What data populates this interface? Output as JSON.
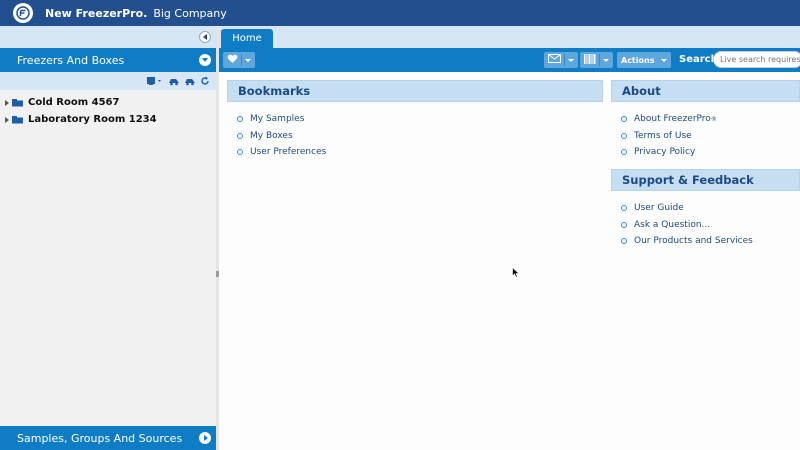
{
  "header": {
    "brand": "New FreezerPro.",
    "company": "Big Company"
  },
  "sidebar": {
    "freezers_header": "Freezers And Boxes",
    "tree": [
      {
        "label": "Cold Room 4567"
      },
      {
        "label": "Laboratory Room 1234"
      }
    ],
    "samples_header": "Samples, Groups And Sources"
  },
  "tabs": [
    {
      "label": "Home",
      "active": true
    }
  ],
  "toolbar": {
    "actions_label": "Actions",
    "search_label": "Search:",
    "search_placeholder": "Live search requires"
  },
  "bookmarks": {
    "title": "Bookmarks",
    "items": [
      "My Samples",
      "My Boxes",
      "User Preferences"
    ]
  },
  "about": {
    "title": "About",
    "items": [
      "About FreezerPro",
      "Terms of Use",
      "Privacy Policy"
    ],
    "registered_mark": "®"
  },
  "support": {
    "title": "Support & Feedback",
    "items": [
      "User Guide",
      "Ask a Question...",
      "Our Products and Services"
    ]
  },
  "colors": {
    "header_bg": "#22508f",
    "accent_blue": "#0f7dc5",
    "light_blue": "#d6e6f5",
    "panel_title_bg": "#c5def2"
  },
  "icons": [
    "freezerpro-logo-icon",
    "collapse-left-icon",
    "chevron-down-icon",
    "chevron-right-icon",
    "add-freezer-icon",
    "truck-icon",
    "refresh-icon",
    "folder-icon",
    "heart-icon",
    "mail-icon",
    "barcode-icon",
    "bullet-icon",
    "mouse-pointer-icon"
  ]
}
